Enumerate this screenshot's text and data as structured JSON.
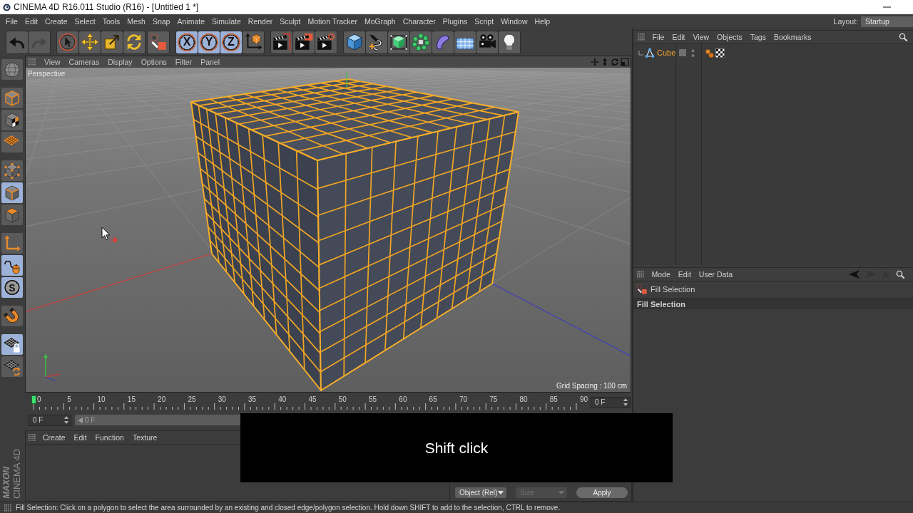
{
  "window": {
    "title": "CINEMA 4D R16.011 Studio (R16) - [Untitled 1 *]"
  },
  "menu_bar": {
    "items": [
      "File",
      "Edit",
      "Create",
      "Select",
      "Tools",
      "Mesh",
      "Snap",
      "Animate",
      "Simulate",
      "Render",
      "Sculpt",
      "Motion Tracker",
      "MoGraph",
      "Character",
      "Plugins",
      "Script",
      "Window",
      "Help"
    ],
    "layout_label": "Layout:",
    "layout_value": "Startup"
  },
  "main_toolbar": {
    "groups": [
      [
        {
          "kind": "undo",
          "on": false,
          "disabled": false
        },
        {
          "kind": "redo",
          "on": false,
          "disabled": true
        }
      ],
      [
        {
          "kind": "select",
          "on": false,
          "disabled": false
        },
        {
          "kind": "move",
          "on": false,
          "disabled": false
        },
        {
          "kind": "scale",
          "on": false,
          "disabled": false
        },
        {
          "kind": "rotate",
          "on": false,
          "disabled": false
        }
      ],
      [
        {
          "kind": "fill",
          "on": false,
          "disabled": false
        }
      ],
      [
        {
          "kind": "axislock",
          "label": "X",
          "on": true,
          "disabled": false
        },
        {
          "kind": "axislock",
          "label": "Y",
          "on": true,
          "disabled": false
        },
        {
          "kind": "axislock",
          "label": "Z",
          "on": true,
          "disabled": false
        },
        {
          "kind": "world",
          "on": false,
          "disabled": false
        }
      ],
      [
        {
          "kind": "render",
          "on": false,
          "disabled": false
        },
        {
          "kind": "picture",
          "on": false,
          "disabled": false
        },
        {
          "kind": "settings",
          "on": false,
          "disabled": false
        }
      ],
      [
        {
          "kind": "cube",
          "on": false,
          "disabled": false
        },
        {
          "kind": "pen",
          "on": false,
          "disabled": false
        },
        {
          "kind": "subdivision",
          "on": false,
          "disabled": false
        },
        {
          "kind": "cloner",
          "on": false,
          "disabled": false
        },
        {
          "kind": "bend",
          "on": false,
          "disabled": false
        },
        {
          "kind": "floor",
          "on": false,
          "disabled": false
        },
        {
          "kind": "camera",
          "on": false,
          "disabled": false
        },
        {
          "kind": "light",
          "on": false,
          "disabled": false
        }
      ]
    ]
  },
  "object_manager": {
    "menu": [
      "File",
      "Edit",
      "View",
      "Objects",
      "Tags",
      "Bookmarks"
    ],
    "objects": [
      {
        "name": "Cube",
        "selected": true,
        "tags": [
          {
            "kind": "dots"
          },
          {
            "kind": "checker"
          }
        ]
      }
    ]
  },
  "side_toolbar": {
    "groups": [
      [
        {
          "kind": "editable",
          "on": false
        }
      ],
      [
        {
          "kind": "model",
          "on": false
        },
        {
          "kind": "texture",
          "on": false
        },
        {
          "kind": "workplane",
          "on": false
        }
      ],
      [
        {
          "kind": "points",
          "on": false
        },
        {
          "kind": "edges",
          "on": true
        },
        {
          "kind": "polygons",
          "on": false
        }
      ],
      [
        {
          "kind": "axis",
          "on": false
        },
        {
          "kind": "tweak",
          "on": true
        },
        {
          "kind": "solo",
          "label": "S",
          "on": true
        }
      ],
      [
        {
          "kind": "snap",
          "on": false
        }
      ],
      [
        {
          "kind": "lockedplane",
          "on": true
        },
        {
          "kind": "planar",
          "on": false
        }
      ]
    ]
  },
  "logo": {
    "brand": "MAXON",
    "product": "CINEMA 4D"
  },
  "viewport": {
    "menu": [
      "View",
      "Cameras",
      "Display",
      "Options",
      "Filter",
      "Panel"
    ],
    "camera": "Perspective",
    "grid_spacing": "Grid Spacing : 100 cm"
  },
  "attribute_manager": {
    "menu": [
      "Mode",
      "Edit",
      "User Data"
    ],
    "nav": [
      {
        "kind": "back",
        "disabled": false
      },
      {
        "kind": "forward",
        "disabled": true
      },
      {
        "kind": "up",
        "disabled": true
      }
    ],
    "tool": "Fill Selection",
    "section": "Fill Selection"
  },
  "timeline": {
    "labels": [
      "0",
      "5",
      "10",
      "15",
      "20",
      "25",
      "30",
      "35",
      "40",
      "45",
      "50",
      "55",
      "60",
      "65",
      "70",
      "75",
      "80",
      "85",
      "90"
    ],
    "level": 0,
    "frame_field": "0 F"
  },
  "transport": {
    "start_field": "0 F",
    "range_label": "0 F"
  },
  "material_manager": {
    "menu": [
      "Create",
      "Edit",
      "Function",
      "Texture"
    ]
  },
  "caption": {
    "text": "Shift click"
  },
  "coordinates": {
    "dropdowns": [
      {
        "value": "Object (Rel)",
        "disabled": false
      },
      {
        "value": "Size",
        "disabled": true
      }
    ],
    "apply_button": "Apply"
  },
  "status_bar": {
    "text": "Fill Selection: Click on a polygon to select the area surrounded by an existing and closed edge/polygon selection. Hold down SHIFT to add to the selection, CTRL to remove."
  }
}
